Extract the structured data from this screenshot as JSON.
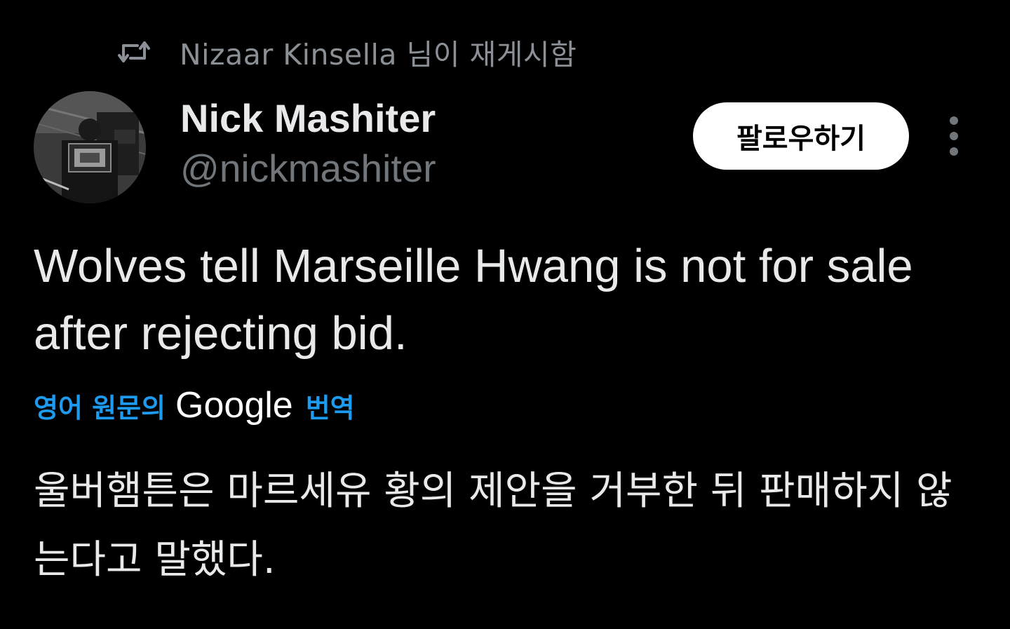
{
  "retweet": {
    "icon": "retweet-icon",
    "text": "Nizaar Kinsella 님이 재게시함"
  },
  "author": {
    "avatar": "avatar",
    "name": "Nick Mashiter",
    "handle": "@nickmashiter"
  },
  "actions": {
    "follow_label": "팔로우하기",
    "more_icon": "more-vertical-icon"
  },
  "tweet": {
    "text": "Wolves tell Marseille Hwang is not for sale after rejecting bid."
  },
  "translation": {
    "prefix": "영어 원문의",
    "provider": "Google",
    "suffix": "번역",
    "text": "울버햄튼은 마르세유 황의 제안을 거부한 뒤 판매하지 않는다고 말했다."
  },
  "colors": {
    "background": "#000000",
    "primary_text": "#e7e9ea",
    "secondary_text": "#71767b",
    "accent": "#1d9bf0",
    "follow_button_bg": "#ffffff"
  }
}
